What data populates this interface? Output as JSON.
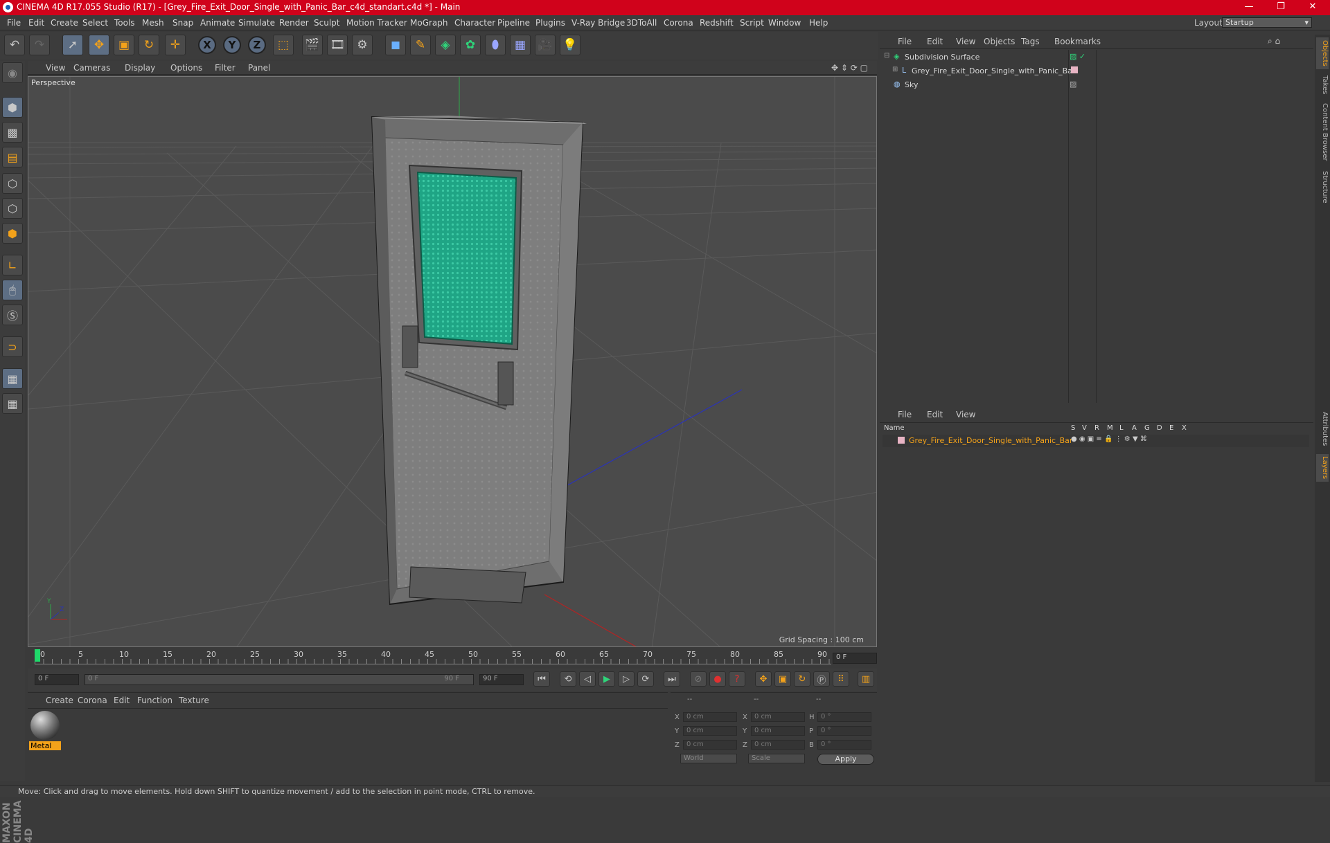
{
  "window": {
    "title": "CINEMA 4D R17.055 Studio (R17) - [Grey_Fire_Exit_Door_Single_with_Panic_Bar_c4d_standart.c4d *] - Main"
  },
  "menubar": [
    "File",
    "Edit",
    "Create",
    "Select",
    "Tools",
    "Mesh",
    "Snap",
    "Animate",
    "Simulate",
    "Render",
    "Sculpt",
    "Motion Tracker",
    "MoGraph",
    "Character",
    "Pipeline",
    "Plugins",
    "V-Ray Bridge",
    "3DToAll",
    "Corona",
    "Redshift",
    "Script",
    "Window",
    "Help"
  ],
  "layout": {
    "label": "Layout:",
    "value": "Startup"
  },
  "viewport": {
    "menu": [
      "View",
      "Cameras",
      "Display",
      "Options",
      "Filter",
      "Panel"
    ],
    "camera_label": "Perspective",
    "grid_spacing": "Grid Spacing : 100 cm"
  },
  "timeline": {
    "ticks": [
      "0",
      "5",
      "10",
      "15",
      "20",
      "25",
      "30",
      "35",
      "40",
      "45",
      "50",
      "55",
      "60",
      "65",
      "70",
      "75",
      "80",
      "85",
      "90"
    ],
    "current_frame": "0 F",
    "start_field": "0 F",
    "range_start": "0 F",
    "range_end": "90 F",
    "end_field": "90 F"
  },
  "material_manager": {
    "menu": [
      "Create",
      "Corona",
      "Edit",
      "Function",
      "Texture"
    ],
    "materials": [
      {
        "name": "Metal"
      }
    ]
  },
  "coordinates": {
    "headers": [
      "--",
      "--",
      "--"
    ],
    "rows": [
      {
        "a": "X",
        "av": "0 cm",
        "b": "X",
        "bv": "0 cm",
        "c": "H",
        "cv": "0 °"
      },
      {
        "a": "Y",
        "av": "0 cm",
        "b": "Y",
        "bv": "0 cm",
        "c": "P",
        "cv": "0 °"
      },
      {
        "a": "Z",
        "av": "0 cm",
        "b": "Z",
        "bv": "0 cm",
        "c": "B",
        "cv": "0 °"
      }
    ],
    "mode": "World",
    "scale": "Scale",
    "apply": "Apply"
  },
  "object_manager": {
    "menu": [
      "File",
      "Edit",
      "View",
      "Objects",
      "Tags",
      "Bookmarks"
    ],
    "objects": [
      {
        "name": "Subdivision Surface"
      },
      {
        "name": "Grey_Fire_Exit_Door_Single_with_Panic_Bar"
      },
      {
        "name": "Sky"
      }
    ]
  },
  "layer_manager": {
    "menu": [
      "File",
      "Edit",
      "View"
    ],
    "columns": [
      "Name",
      "S",
      "V",
      "R",
      "M",
      "L",
      "A",
      "G",
      "D",
      "E",
      "X"
    ],
    "layers": [
      {
        "name": "Grey_Fire_Exit_Door_Single_with_Panic_Bar"
      }
    ]
  },
  "right_tabs": [
    "Objects",
    "Takes",
    "Content Browser",
    "Structure",
    "Attributes",
    "Layers"
  ],
  "status": "Move: Click and drag to move elements. Hold down SHIFT to quantize movement / add to the selection in point mode, CTRL to remove.",
  "brand": "MAXON CINEMA 4D",
  "colors": {
    "titlebar": "#d0021b",
    "accent": "#f3a21a",
    "glass": "#1fa585"
  }
}
